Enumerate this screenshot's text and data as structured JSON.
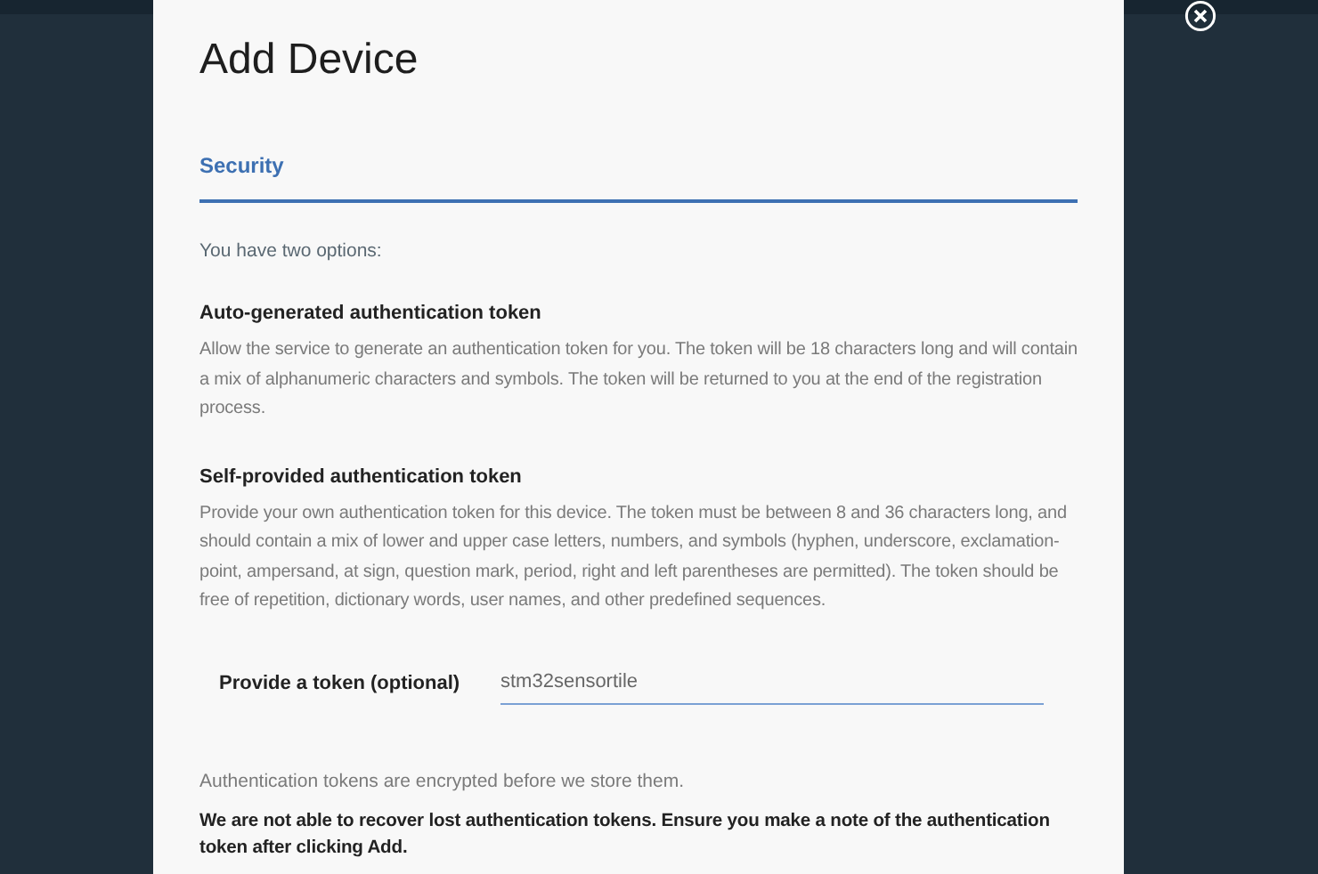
{
  "dialog": {
    "title": "Add Device",
    "tabs": [
      {
        "label": "Security",
        "selected": true
      }
    ],
    "intro": "You have two options:",
    "sections": [
      {
        "heading": "Auto-generated authentication token",
        "text": "Allow the service to generate an authentication token for you. The token will be 18 characters long and will contain a mix of alphanumeric characters and symbols. The token will be returned to you at the end of the registration process."
      },
      {
        "heading": "Self-provided authentication token",
        "text": "Provide your own authentication token for this device. The token must be between 8 and 36 characters long, and should contain a mix of lower and upper case letters, numbers, and symbols (hyphen, underscore, exclamation-point, ampersand, at sign, question mark, period, right and left parentheses are permitted). The token should be free of repetition, dictionary words, user names, and other predefined sequences."
      }
    ],
    "token_field": {
      "label": "Provide a token (optional)",
      "value": "stm32sensortile"
    },
    "note": "Authentication tokens are encrypted before we store them.",
    "warning": "We are not able to recover lost authentication tokens. Ensure you make a note of the authentication token after clicking Add."
  }
}
